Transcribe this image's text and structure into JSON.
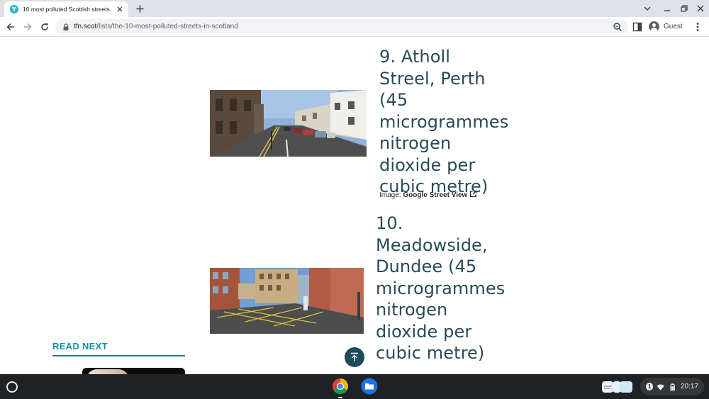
{
  "browser": {
    "tab_title": "10 most polluted Scottish streets",
    "url_host": "tfn.scot",
    "url_path": "/lists/the-10-most-polluted-streets-in-scotland",
    "profile_label": "Guest"
  },
  "article": {
    "entries": [
      {
        "title": "9. Atholl Streel, Perth (45 microgrammes nitrogen dioxide per cubic metre)"
      },
      {
        "title": "10. Meadowside, Dundee (45 microgrammes nitrogen dioxide per cubic metre)"
      }
    ],
    "caption_prefix": "Image:",
    "caption_link": "Google Street View",
    "read_next": "READ NEXT"
  },
  "shelf": {
    "notification_count": "1",
    "time": "20:17"
  },
  "colors": {
    "heading": "#2a4a58",
    "accent": "#1591a6",
    "back_to_top": "#1d4a5a"
  },
  "icons": [
    "tfn-favicon",
    "close-icon",
    "plus-icon",
    "chevron-down-icon",
    "minimize-icon",
    "restore-icon",
    "close-window-icon",
    "back-icon",
    "forward-icon",
    "reload-icon",
    "lock-icon",
    "zoom-icon",
    "side-panel-icon",
    "avatar",
    "more-vert-icon",
    "external-link-icon",
    "arrow-up-icon",
    "launcher-icon",
    "chrome-icon",
    "files-icon",
    "wifi-icon",
    "battery-icon"
  ]
}
